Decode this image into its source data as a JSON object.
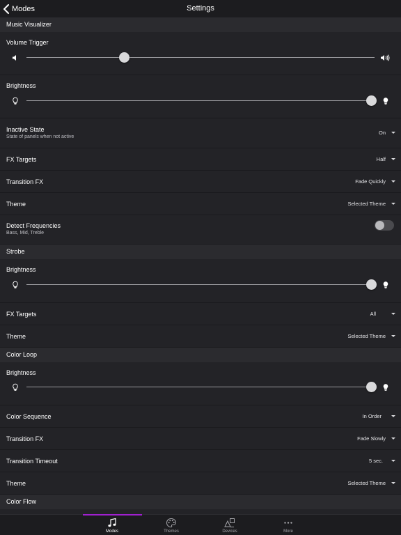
{
  "nav": {
    "back_label": "Modes",
    "title": "Settings"
  },
  "music": {
    "header": "Music Visualizer",
    "volume_label": "Volume Trigger",
    "volume_level": 0.28,
    "brightness_label": "Brightness",
    "brightness_level": 0.99,
    "inactive_label": "Inactive State",
    "inactive_sub": "State of panels when not active",
    "inactive_value": "On",
    "fx_targets_label": "FX Targets",
    "fx_targets_value": "Half",
    "transition_label": "Transition FX",
    "transition_value": "Fade Quickly",
    "theme_label": "Theme",
    "theme_value": "Selected Theme",
    "detect_label": "Detect Frequencies",
    "detect_sub": "Bass, Mid, Treble",
    "detect_on": false
  },
  "strobe": {
    "header": "Strobe",
    "brightness_label": "Brightness",
    "brightness_level": 0.99,
    "fx_targets_label": "FX Targets",
    "fx_targets_value": "All",
    "theme_label": "Theme",
    "theme_value": "Selected Theme"
  },
  "color_loop": {
    "header": "Color Loop",
    "brightness_label": "Brightness",
    "brightness_level": 0.99,
    "sequence_label": "Color Sequence",
    "sequence_value": "In Order",
    "transition_label": "Transition FX",
    "transition_value": "Fade Slowly",
    "timeout_label": "Transition Timeout",
    "timeout_value": "5 sec.",
    "theme_label": "Theme",
    "theme_value": "Selected Theme"
  },
  "color_flow": {
    "header": "Color Flow"
  },
  "tabs": [
    {
      "label": "Modes",
      "icon": "music-note-icon",
      "active": true
    },
    {
      "label": "Themes",
      "icon": "palette-icon",
      "active": false
    },
    {
      "label": "Devices",
      "icon": "devices-icon",
      "active": false
    },
    {
      "label": "More",
      "icon": "more-icon",
      "active": false
    }
  ],
  "colors": {
    "accent": "#a020d0",
    "background": "#1c1c1f",
    "row": "#232327",
    "header": "#2b2b2f"
  }
}
